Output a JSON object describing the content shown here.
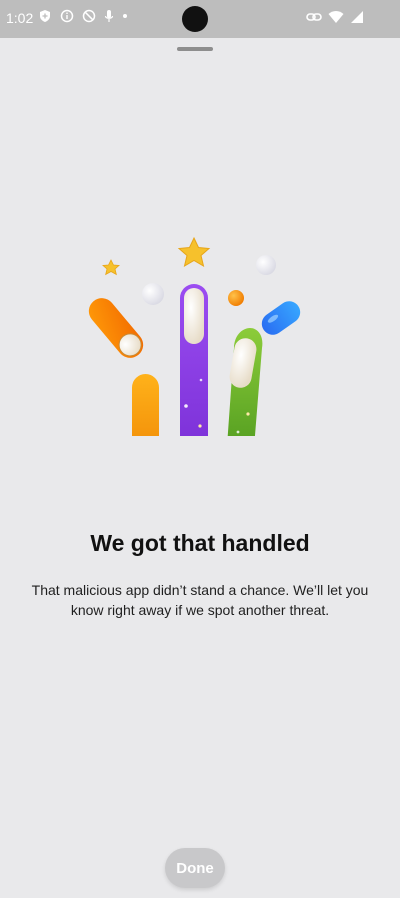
{
  "status_bar": {
    "time": "1:02",
    "left_icons": [
      "shield-icon",
      "info-icon",
      "blocked-icon",
      "mic-icon",
      "dot-icon"
    ],
    "right_icons": [
      "link-icon",
      "wifi-icon",
      "signal-icon"
    ]
  },
  "sheet": {
    "title": "We got that handled",
    "body": "That malicious app didn’t stand a chance. We’ll let you know right away if we spot another threat.",
    "done_label": "Done"
  },
  "colors": {
    "orange": "#f39a12",
    "purple": "#8a3fe3",
    "green": "#63b02a",
    "blue": "#2f7cf6",
    "star": "#f6c12c",
    "background": "#e9e9eb"
  }
}
